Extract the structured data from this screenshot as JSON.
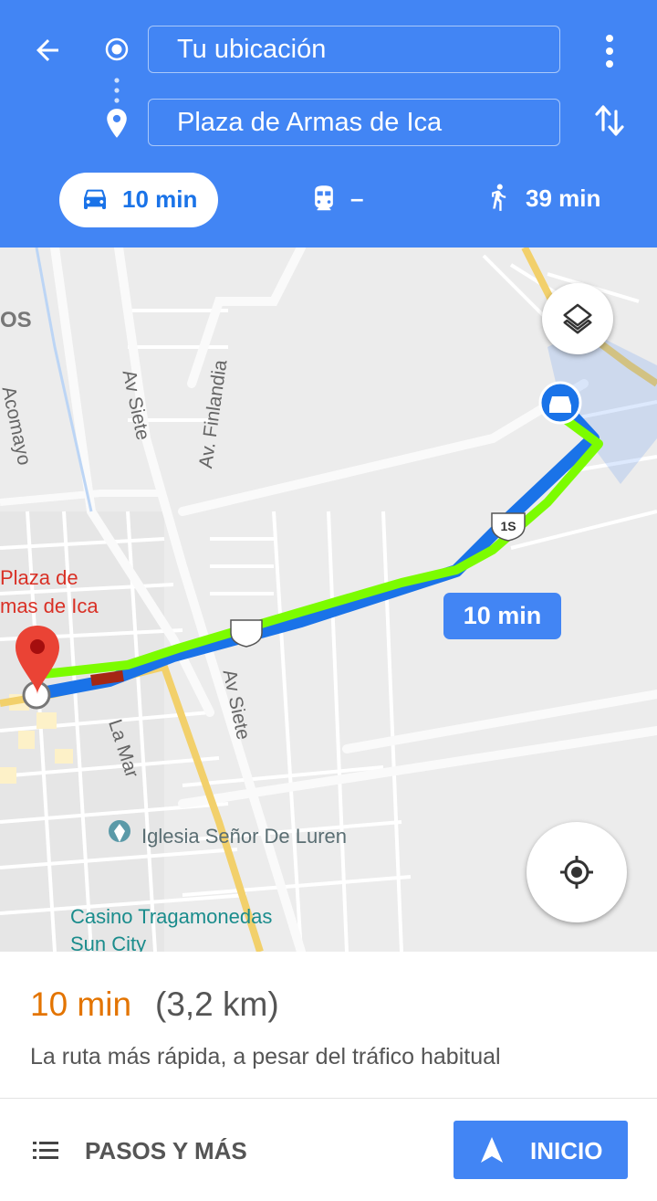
{
  "header": {
    "origin": "Tu ubicación",
    "destination": "Plaza de Armas de Ica",
    "modes": {
      "drive": "10 min",
      "transit": "–",
      "walk": "39 min"
    }
  },
  "map": {
    "labels": {
      "os": "OS",
      "acomayo": "Acomayo",
      "av_siete_1": "Av Siete",
      "av_finlandia": "Av. Finlandia",
      "plaza_1": "Plaza de",
      "plaza_2": "mas de Ica",
      "av_siete_2": "Av Siete",
      "la_mar": "La Mar",
      "iglesia": "Iglesia Señor De Luren",
      "casino_1": "Casino Tragamonedas",
      "casino_2": "Sun City",
      "route_shield": "1S"
    },
    "route_time": "10 min",
    "colors": {
      "route_traffic_free": "#7cfc00",
      "route_blue": "#1a73e8",
      "pin": "#ea4335",
      "label_red": "#d93025",
      "label_teal": "#1a8c8c"
    }
  },
  "summary": {
    "time": "10 min",
    "distance": "(3,2 km)",
    "description": "La ruta más rápida, a pesar del tráfico habitual"
  },
  "actions": {
    "steps_label": "PASOS Y MÁS",
    "start_label": "INICIO"
  },
  "icons": [
    "back-arrow-icon",
    "origin-dot-icon",
    "destination-pin-icon",
    "more-vert-icon",
    "swap-icon",
    "car-icon",
    "train-icon",
    "walk-icon",
    "layers-icon",
    "my-location-icon",
    "list-icon",
    "navigation-arrow-icon"
  ]
}
